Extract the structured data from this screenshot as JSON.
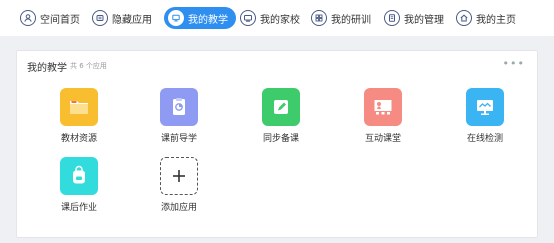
{
  "nav": {
    "items": [
      {
        "label": "空间首页",
        "icon": "user-icon"
      },
      {
        "label": "隐藏应用",
        "icon": "eye-off-icon"
      },
      {
        "label": "我的教学",
        "icon": "monitor-icon",
        "active": true
      },
      {
        "label": "我的家校",
        "icon": "screen-icon"
      },
      {
        "label": "我的研训",
        "icon": "grid-icon"
      },
      {
        "label": "我的管理",
        "icon": "document-icon"
      },
      {
        "label": "我的主页",
        "icon": "home-icon"
      }
    ]
  },
  "section": {
    "title": "我的教学",
    "count_text": "共 6 个应用",
    "more": "•••"
  },
  "apps": [
    {
      "label": "教材资源",
      "color": "#f9bd30",
      "icon": "folder-icon"
    },
    {
      "label": "课前导学",
      "color": "#8f9bf2",
      "icon": "clipboard-icon"
    },
    {
      "label": "同步备课",
      "color": "#3ecb6c",
      "icon": "edit-icon"
    },
    {
      "label": "互动课堂",
      "color": "#f58b82",
      "icon": "presentation-icon"
    },
    {
      "label": "在线检测",
      "color": "#3ab4f2",
      "icon": "monitor-chart-icon"
    },
    {
      "label": "课后作业",
      "color": "#33dcdc",
      "icon": "backpack-icon"
    },
    {
      "label": "添加应用",
      "color": "#ffffff",
      "icon": "plus-icon"
    }
  ],
  "colors": {
    "accent": "#2e8ff0",
    "nav_icon": "#4a5a86"
  }
}
